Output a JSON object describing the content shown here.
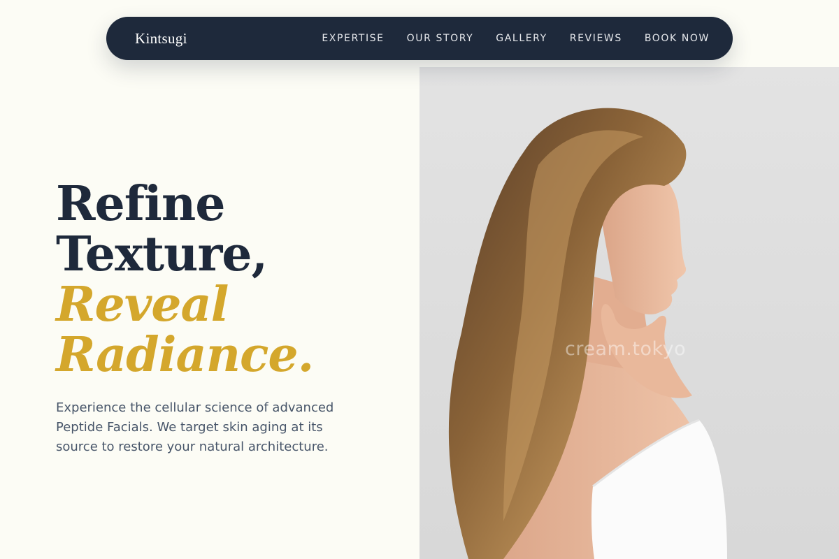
{
  "nav": {
    "brand": "Kintsugi",
    "links": [
      {
        "label": "EXPERTISE"
      },
      {
        "label": "OUR STORY"
      },
      {
        "label": "GALLERY"
      },
      {
        "label": "REVIEWS"
      },
      {
        "label": "BOOK NOW"
      }
    ]
  },
  "hero": {
    "line1": "Refine",
    "line2": "Texture,",
    "line3": "Reveal",
    "line4": "Radiance.",
    "description": "Experience the cellular science of advanced Peptide Facials. We target skin aging at its source to restore your natural architecture."
  },
  "image": {
    "subject": "woman-profile-photo",
    "watermark": "cream.tokyo"
  },
  "colors": {
    "background": "#fcfcf5",
    "navy": "#1e293b",
    "gold": "#d4a72c",
    "text_muted": "#475569"
  }
}
